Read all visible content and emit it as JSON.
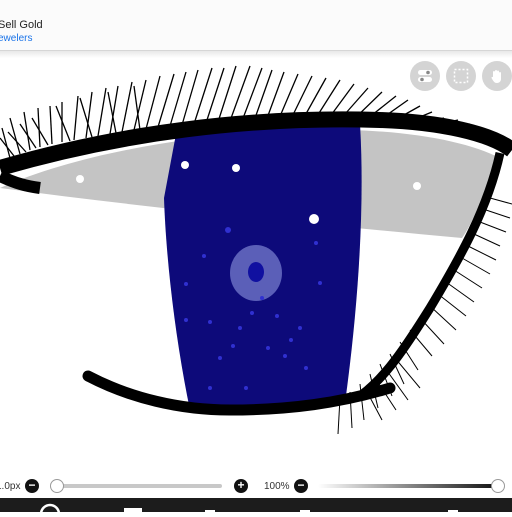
{
  "ad": {
    "title": "Sell Gold",
    "subtitle": "ewelers"
  },
  "toolbar_icons": [
    "layers-toggle-icon",
    "selection-icon",
    "hand-pan-icon"
  ],
  "brush": {
    "size_label": "1.0px",
    "size_minus": "−",
    "size_plus": "+",
    "size_level": 0.02
  },
  "opacity": {
    "label": "100%",
    "minus": "−",
    "level": 1.0
  },
  "colors": {
    "iris": "#0d0a7a",
    "sclera": "#c4c4c4",
    "outline": "#000000",
    "pupil": "#5b5fb8",
    "accent": "#1a73e8"
  }
}
